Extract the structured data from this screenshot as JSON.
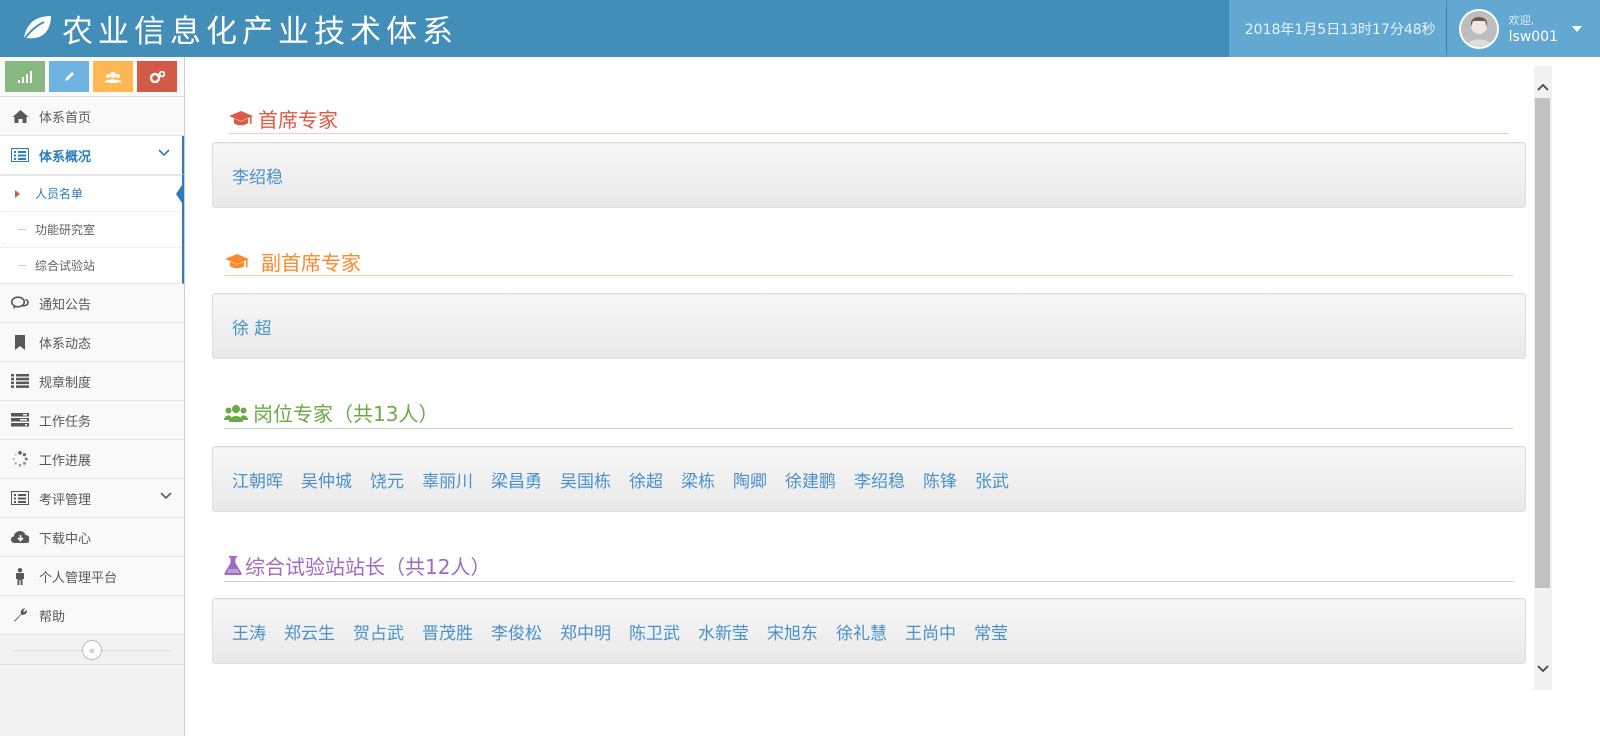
{
  "header": {
    "title": "农业信息化产业技术体系",
    "datetime": "2018年1月5日13时17分48秒",
    "welcome": "欢迎,",
    "username": "lsw001",
    "brand_color": "#438eb9"
  },
  "sidebar": {
    "shortcuts": [
      {
        "icon": "signal-icon",
        "color": "#87b87f"
      },
      {
        "icon": "pencil-icon",
        "color": "#6fb3e0"
      },
      {
        "icon": "users-icon",
        "color": "#ffb752"
      },
      {
        "icon": "cogs-icon",
        "color": "#d15b47"
      }
    ],
    "items": [
      {
        "label": "体系首页",
        "icon": "home-icon"
      },
      {
        "label": "体系概况",
        "icon": "list-alt-icon",
        "active": true,
        "children": [
          {
            "label": "人员名单",
            "active": true
          },
          {
            "label": "功能研究室"
          },
          {
            "label": "综合试验站"
          }
        ]
      },
      {
        "label": "通知公告",
        "icon": "comments-icon"
      },
      {
        "label": "体系动态",
        "icon": "bookmark-icon"
      },
      {
        "label": "规章制度",
        "icon": "list-icon"
      },
      {
        "label": "工作任务",
        "icon": "tasks-icon"
      },
      {
        "label": "工作进展",
        "icon": "spinner-icon"
      },
      {
        "label": "考评管理",
        "icon": "list-alt-icon"
      },
      {
        "label": "下载中心",
        "icon": "cloud-download-icon"
      },
      {
        "label": "个人管理平台",
        "icon": "male-icon"
      },
      {
        "label": "帮助",
        "icon": "wrench-icon"
      }
    ]
  },
  "main": {
    "sections": [
      {
        "title": "首席专家",
        "icon": "graduation-cap-icon",
        "color": "#dd5a43",
        "names": [
          "李绍稳"
        ]
      },
      {
        "title": "副首席专家",
        "icon": "graduation-cap-icon",
        "color": "#ff892a",
        "names": [
          "徐 超"
        ]
      },
      {
        "title": "岗位专家（共13人）",
        "icon": "users-icon",
        "color": "#69aa46",
        "names": [
          "江朝晖",
          "吴仲城",
          "饶元",
          "辜丽川",
          "梁昌勇",
          "吴国栋",
          "徐超",
          "梁栋",
          "陶卿",
          "徐建鹏",
          "李绍稳",
          "陈锋",
          "张武"
        ]
      },
      {
        "title": "综合试验站站长（共12人）",
        "icon": "flask-icon",
        "color": "#a069c3",
        "names": [
          "王涛",
          "郑云生",
          "贺占武",
          "晋茂胜",
          "李俊松",
          "郑中明",
          "陈卫武",
          "水新莹",
          "宋旭东",
          "徐礼慧",
          "王尚中",
          "常莹"
        ]
      }
    ]
  }
}
